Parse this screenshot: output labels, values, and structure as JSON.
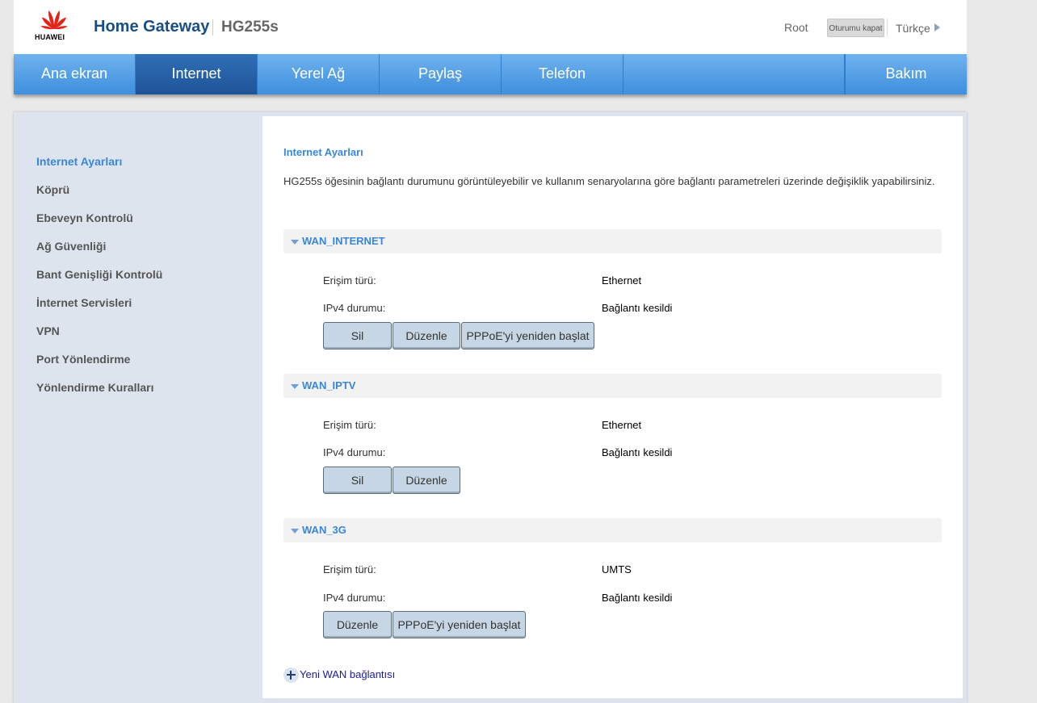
{
  "header": {
    "logo_text": "HUAWEI",
    "title": "Home Gateway",
    "model": "HG255s",
    "user": "Root",
    "logout_label": "Oturumu kapat",
    "language": "Türkçe"
  },
  "nav": {
    "items": [
      {
        "label": "Ana ekran"
      },
      {
        "label": "Internet"
      },
      {
        "label": "Yerel Ağ"
      },
      {
        "label": "Paylaş"
      },
      {
        "label": "Telefon"
      },
      {
        "label": ""
      },
      {
        "label": "Bakım"
      }
    ],
    "active": "Internet"
  },
  "sidebar": {
    "items": [
      {
        "label": "Internet Ayarları"
      },
      {
        "label": "Köprü"
      },
      {
        "label": "Ebeveyn Kontrolü"
      },
      {
        "label": "Ağ Güvenliği"
      },
      {
        "label": "Bant Genişliği Kontrolü"
      },
      {
        "label": "İnternet Servisleri"
      },
      {
        "label": "VPN"
      },
      {
        "label": "Port Yönlendirme"
      },
      {
        "label": "Yönlendirme Kuralları"
      }
    ],
    "active": "Internet Ayarları"
  },
  "main": {
    "title": "Internet Ayarları",
    "description": "HG255s öğesinin bağlantı durumunu görüntüleyebilir ve kullanım senaryolarına göre bağlantı parametreleri üzerinde değişiklik yapabilirsiniz.",
    "sections": [
      {
        "title": "WAN_INTERNET",
        "access_label": "Erişim türü:",
        "access_value": "Ethernet",
        "ipv4_label": "IPv4 durumu:",
        "ipv4_value": "Bağlantı kesildi",
        "buttons": [
          "Sil",
          "Düzenle",
          "PPPoE'yi yeniden başlat"
        ]
      },
      {
        "title": "WAN_IPTV",
        "access_label": "Erişim türü:",
        "access_value": "Ethernet",
        "ipv4_label": "IPv4 durumu:",
        "ipv4_value": "Bağlantı kesildi",
        "buttons": [
          "Sil",
          "Düzenle"
        ]
      },
      {
        "title": "WAN_3G",
        "access_label": "Erişim türü:",
        "access_value": "UMTS",
        "ipv4_label": "IPv4 durumu:",
        "ipv4_value": "Bağlantı kesildi",
        "buttons": [
          "Düzenle",
          "PPPoE'yi yeniden başlat"
        ]
      }
    ],
    "add_wan_label": "Yeni WAN bağlantısı"
  },
  "colors": {
    "accent": "#3a86d9",
    "nav_gradient_top": "#6fb2ee",
    "nav_active": "#1f5398",
    "brand": "#e2231a",
    "button_bg": "#c6d6e4"
  }
}
